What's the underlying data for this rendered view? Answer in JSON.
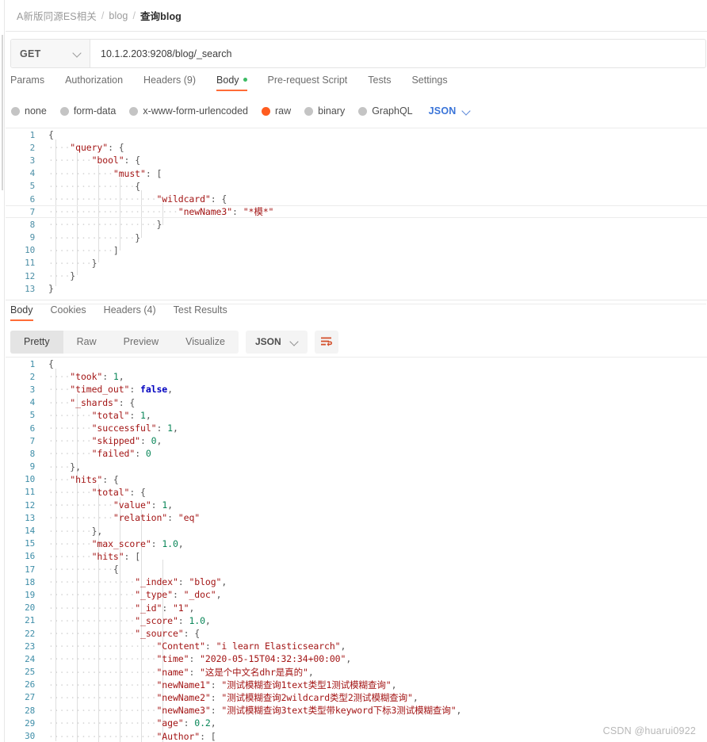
{
  "breadcrumb": {
    "items": [
      "A新版同源ES相关",
      "blog",
      "查询blog"
    ],
    "separator": "/"
  },
  "request": {
    "method": "GET",
    "url": "10.1.2.203:9208/blog/_search",
    "tabs": [
      {
        "label": "Params",
        "active": false,
        "dot": false
      },
      {
        "label": "Authorization",
        "active": false,
        "dot": false
      },
      {
        "label": "Headers (9)",
        "active": false,
        "dot": false
      },
      {
        "label": "Body",
        "active": true,
        "dot": true
      },
      {
        "label": "Pre-request Script",
        "active": false,
        "dot": false
      },
      {
        "label": "Tests",
        "active": false,
        "dot": false
      },
      {
        "label": "Settings",
        "active": false,
        "dot": false
      }
    ],
    "body_types": [
      {
        "label": "none",
        "selected": false
      },
      {
        "label": "form-data",
        "selected": false
      },
      {
        "label": "x-www-form-urlencoded",
        "selected": false
      },
      {
        "label": "raw",
        "selected": true
      },
      {
        "label": "binary",
        "selected": false
      },
      {
        "label": "GraphQL",
        "selected": false
      }
    ],
    "format": "JSON",
    "body_lines": [
      "{",
      "    \"query\": {",
      "        \"bool\": {",
      "            \"must\": [",
      "                {",
      "                    \"wildcard\": {",
      "                        \"newName3\": \"*模*\"",
      "                    }",
      "                }",
      "            ]",
      "        }",
      "    }",
      "}"
    ],
    "active_line": 7
  },
  "response": {
    "tabs": [
      {
        "label": "Body",
        "active": true
      },
      {
        "label": "Cookies",
        "active": false
      },
      {
        "label": "Headers (4)",
        "active": false
      },
      {
        "label": "Test Results",
        "active": false
      }
    ],
    "views": [
      {
        "label": "Pretty",
        "active": true
      },
      {
        "label": "Raw",
        "active": false
      },
      {
        "label": "Preview",
        "active": false
      },
      {
        "label": "Visualize",
        "active": false
      }
    ],
    "format": "JSON",
    "wrap_icon": "wrap-lines-icon",
    "body_lines": [
      "{",
      "    \"took\": 1,",
      "    \"timed_out\": false,",
      "    \"_shards\": {",
      "        \"total\": 1,",
      "        \"successful\": 1,",
      "        \"skipped\": 0,",
      "        \"failed\": 0",
      "    },",
      "    \"hits\": {",
      "        \"total\": {",
      "            \"value\": 1,",
      "            \"relation\": \"eq\"",
      "        },",
      "        \"max_score\": 1.0,",
      "        \"hits\": [",
      "            {",
      "                \"_index\": \"blog\",",
      "                \"_type\": \"_doc\",",
      "                \"_id\": \"1\",",
      "                \"_score\": 1.0,",
      "                \"_source\": {",
      "                    \"Content\": \"i learn Elasticsearch\",",
      "                    \"time\": \"2020-05-15T04:32:34+00:00\",",
      "                    \"name\": \"这是个中文名dhr是真的\",",
      "                    \"newName1\": \"测试模糊查询1text类型1测试模糊查询\",",
      "                    \"newName2\": \"测试模糊查询2wildcard类型2测试模糊查询\",",
      "                    \"newName3\": \"测试模糊查询3text类型带keyword下标3测试模糊查询\",",
      "                    \"age\": 0.2,",
      "                    \"Author\": ["
    ]
  },
  "watermark": "CSDN @huarui0922",
  "colors": {
    "accent": "#ff6c37",
    "selected_radio": "#ff5c1f",
    "link": "#3a74d8",
    "green_dot": "#3dbb64",
    "line_number": "#4d8fa6"
  }
}
